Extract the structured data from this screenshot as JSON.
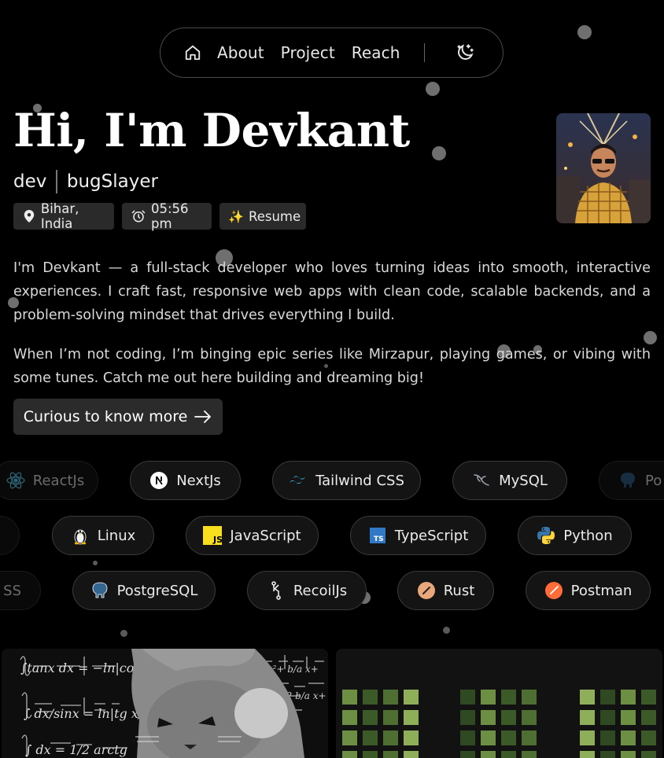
{
  "nav": {
    "home_icon": "home-icon",
    "links": [
      "About",
      "Project",
      "Reach"
    ],
    "theme_icon": "moon-stars-icon"
  },
  "hero": {
    "title": "Hi, I'm Devkant",
    "role1": "dev",
    "role2": "bugSlayer",
    "location": "Bihar, India",
    "time": "05:56 pm",
    "resume": "Resume"
  },
  "about": {
    "p1": "I'm Devkant — a full-stack developer who loves turning ideas into smooth, interactive experiences. I craft fast, responsive web apps with clean code, scalable backends, and a problem-solving mindset that drives everything I build.",
    "p2": "When I’m not coding, I’m binging epic series like Mirzapur, playing games, or vibing with some tunes. Catch me out here building and dreaming big!",
    "cta": "Curious to know more"
  },
  "skills": {
    "row1": [
      "ReactJs",
      "NextJs",
      "Tailwind CSS",
      "MySQL",
      "Po"
    ],
    "row2": [
      "Linux",
      "JavaScript",
      "TypeScript",
      "Python"
    ],
    "row3": [
      "SS",
      "PostgreSQL",
      "RecoilJs",
      "Rust",
      "Postman"
    ]
  },
  "colors": {
    "background": "#000000",
    "pill_bg": "#141414",
    "chip_bg": "#2a2a2a"
  }
}
